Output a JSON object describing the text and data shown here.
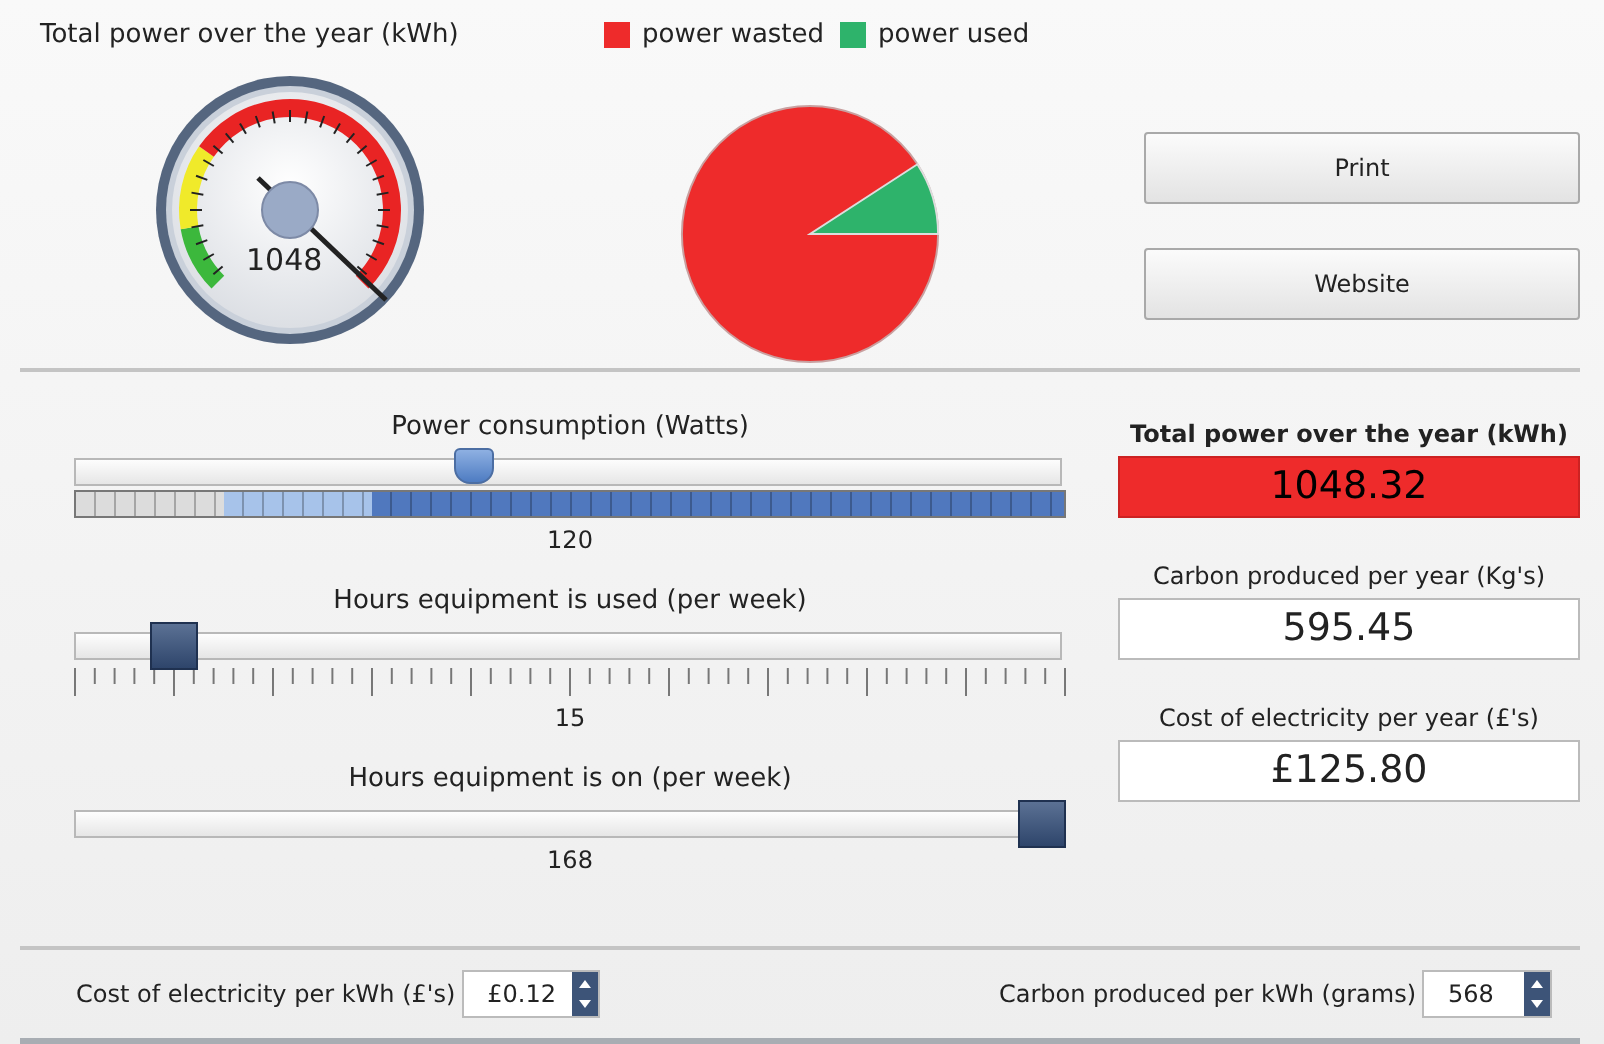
{
  "gauge": {
    "title": "Total power over the year (kWh)",
    "value": "1048"
  },
  "legend": [
    {
      "label": "power wasted",
      "color": "#ee2b2b"
    },
    {
      "label": "power used",
      "color": "#2eb36b"
    }
  ],
  "buttons": [
    "Print",
    "Website"
  ],
  "sliders": [
    {
      "kind": "range",
      "label": "Power consumption (Watts)",
      "level": 0.4,
      "reading": "120"
    },
    {
      "kind": "ticks",
      "label": "Hours equipment is used (per week)",
      "level": 0.08,
      "reading": "15"
    },
    {
      "kind": "plain",
      "label": "Hours equipment is on (per week)",
      "level": 1,
      "reading": "168"
    }
  ],
  "outputs": [
    {
      "label": "Total power over the year (kWh)",
      "value": "1048.32",
      "alert": true
    },
    {
      "label": "Carbon produced per year (Kg's)",
      "value": "595.45",
      "alert": false
    },
    {
      "label": "Cost of electricity per year (£'s)",
      "value": "£125.80",
      "alert": false
    }
  ],
  "spinners": [
    {
      "label": "Cost of electricity per kWh (£'s)",
      "value": "£0.12"
    },
    {
      "label": "Carbon produced per kWh (grams)",
      "value": "568"
    }
  ]
}
